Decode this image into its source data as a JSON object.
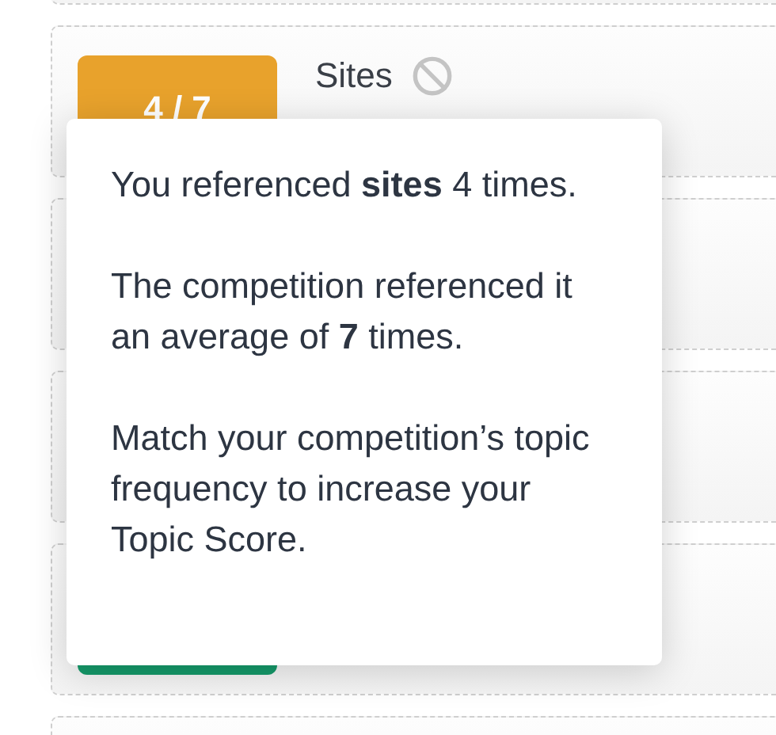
{
  "cards": [
    {
      "kind": "topic"
    },
    {
      "kind": "topic",
      "badge": "4 / 7",
      "color": "#e8a22c",
      "title": "Sites",
      "excluded": true
    },
    {
      "kind": "topic"
    },
    {
      "kind": "topic"
    },
    {
      "kind": "topic",
      "color": "#159a6a"
    },
    {
      "kind": "topic"
    }
  ],
  "tooltip": {
    "paragraphs": [
      "You referenced **sites** 4 times.",
      "The competition referenced it an average of **7** times.",
      "Match your competition’s topic frequency to increase your Topic Score."
    ]
  }
}
